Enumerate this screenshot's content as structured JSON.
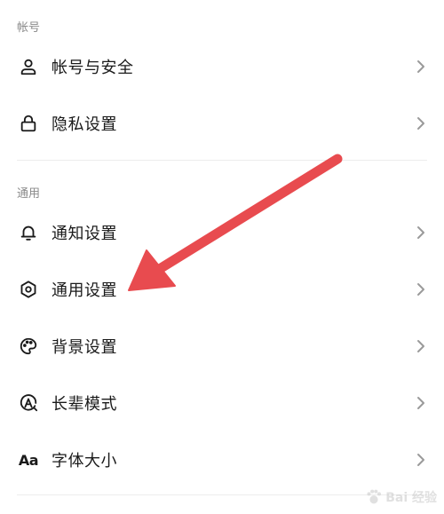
{
  "sections": [
    {
      "title": "帐号",
      "items": [
        {
          "label": "帐号与安全",
          "icon": "person-icon"
        },
        {
          "label": "隐私设置",
          "icon": "lock-icon"
        }
      ]
    },
    {
      "title": "通用",
      "items": [
        {
          "label": "通知设置",
          "icon": "bell-icon"
        },
        {
          "label": "通用设置",
          "icon": "gear-icon"
        },
        {
          "label": "背景设置",
          "icon": "palette-icon"
        },
        {
          "label": "长辈模式",
          "icon": "elder-mode-icon"
        },
        {
          "label": "字体大小",
          "icon": "font-size-icon",
          "icon_text": "Aa"
        }
      ]
    }
  ],
  "annotation": {
    "type": "arrow",
    "color": "#e84b4f",
    "points_to": "通用设置"
  },
  "watermark": {
    "text": "Bai 经验"
  }
}
